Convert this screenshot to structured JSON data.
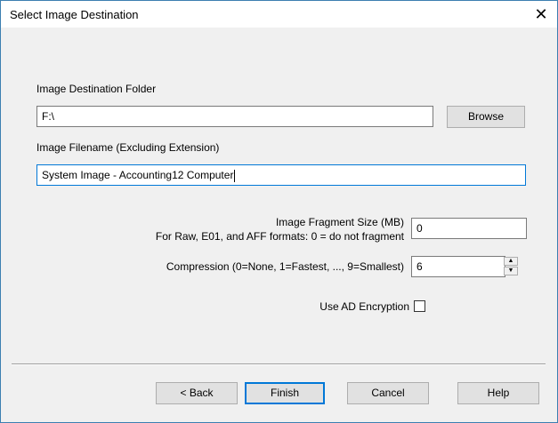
{
  "dialog": {
    "title": "Select Image Destination",
    "close_glyph": "✕"
  },
  "destination_folder": {
    "label": "Image Destination Folder",
    "value": "F:\\",
    "browse_label": "Browse"
  },
  "filename": {
    "label": "Image Filename (Excluding Extension)",
    "value": "System Image - Accounting12 Computer"
  },
  "fragment_size": {
    "label_line1": "Image Fragment Size (MB)",
    "label_line2": "For Raw, E01, and AFF formats: 0 = do not fragment",
    "value": "0"
  },
  "compression": {
    "label": "Compression (0=None, 1=Fastest, ..., 9=Smallest)",
    "value": "6",
    "up_glyph": "▲",
    "down_glyph": "▼"
  },
  "encryption": {
    "label": "Use AD Encryption",
    "checked": false
  },
  "buttons": {
    "back": "< Back",
    "finish": "Finish",
    "cancel": "Cancel",
    "help": "Help"
  }
}
